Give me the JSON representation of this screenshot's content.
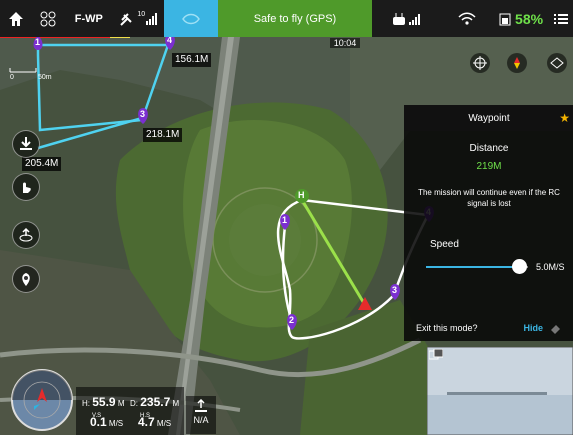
{
  "topbar": {
    "home_icon": "home-icon",
    "aircraft_icon": "aircraft-icon",
    "mode": "F-WP",
    "gps_count": "10",
    "vision_icon": "vision-icon",
    "status": "Safe to fly (GPS)",
    "rc_icon": "remote-controller-icon",
    "wifi_icon": "wifi-icon",
    "battery_percent": "58%",
    "menu_icon": "menu-icon"
  },
  "time": "10:04",
  "scale": {
    "zero": "0",
    "distance": "50m"
  },
  "waypoints": [
    {
      "num": "1"
    },
    {
      "num": "2"
    },
    {
      "num": "3"
    },
    {
      "num": "4"
    }
  ],
  "map_labels": {
    "home": "H",
    "dist_156": "156.1M",
    "dist_218": "218.1M",
    "dist_205": "205.4M"
  },
  "panel": {
    "title": "Waypoint",
    "distance_label": "Distance",
    "distance_value": "219M",
    "rc_notice": "The mission will continue even if the RC signal is lost",
    "speed_label": "Speed",
    "speed_value": "5.0M/S",
    "speed_fraction": 0.85,
    "exit_label": "Exit this mode?",
    "hide_label": "Hide"
  },
  "telemetry": {
    "h_label": "H:",
    "h_value": "55.9",
    "h_unit": "M",
    "d_label": "D:",
    "d_value": "235.7",
    "d_unit": "M",
    "vs_label": "V.S",
    "vs_value": "0.1",
    "vs_unit": "M/S",
    "hs_label": "H.S",
    "hs_value": "4.7",
    "hs_unit": "M/S",
    "na": "N/A"
  },
  "colors": {
    "accent": "#3bb5e3",
    "safe_green": "#4f9a2a",
    "battery_green": "#6fe04a",
    "waypoint_purple": "#7b2fd0",
    "star_gold": "#f5b400"
  }
}
